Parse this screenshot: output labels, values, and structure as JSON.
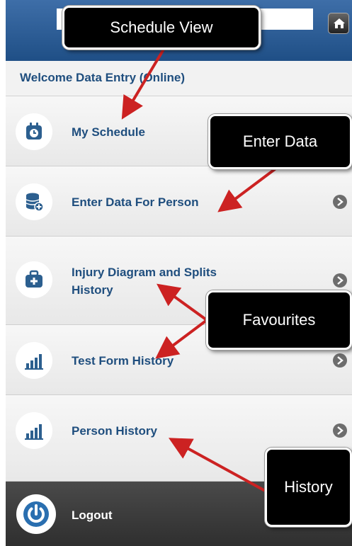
{
  "header": {
    "home_icon": "home-icon"
  },
  "welcome_text": "Welcome Data Entry (Online)",
  "menu": [
    {
      "label": "My Schedule",
      "icon": "schedule-icon",
      "has_chevron": false
    },
    {
      "label": "Enter Data For Person",
      "icon": "database-add-icon",
      "has_chevron": true
    },
    {
      "label_line1": "Injury Diagram and Splits",
      "label_line2": "History",
      "icon": "medical-kit-icon",
      "has_chevron": true
    },
    {
      "label": "Test Form History",
      "icon": "bar-chart-icon",
      "has_chevron": true
    },
    {
      "label": "Person History",
      "icon": "bar-chart-icon",
      "has_chevron": true
    }
  ],
  "logout": {
    "label": "Logout",
    "icon": "power-icon"
  },
  "callouts": {
    "schedule_view": "Schedule View",
    "enter_data": "Enter Data",
    "favourites": "Favourites",
    "history": "History"
  },
  "colors": {
    "header": "#2a5b93",
    "link_text": "#1f4e7e",
    "arrow": "#cc2222",
    "callout_bg": "#000000"
  }
}
